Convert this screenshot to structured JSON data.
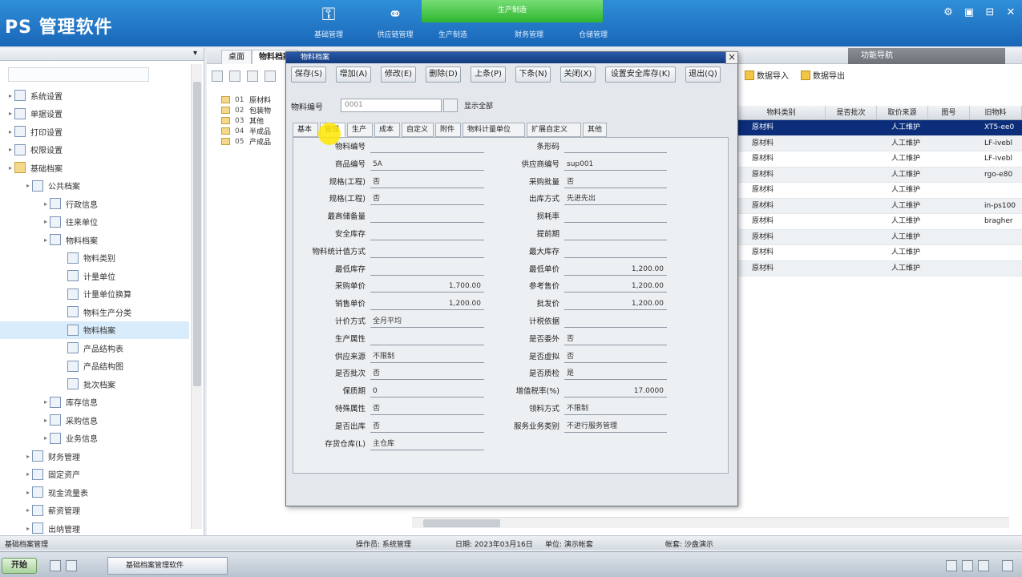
{
  "app": {
    "title": "PS 管理软件"
  },
  "nav": [
    {
      "label": "基础管理",
      "icon": "key-icon"
    },
    {
      "label": "供应链管理",
      "icon": "link-icon"
    },
    {
      "label": "生产制造",
      "icon": "factory-icon"
    },
    {
      "label": "财务管理",
      "icon": "ledger-icon"
    },
    {
      "label": "仓储管理",
      "icon": "warehouse-icon"
    }
  ],
  "window_controls": [
    "⚙",
    "▣",
    "⊟",
    "✕"
  ],
  "left_tree": [
    {
      "label": "系统设置",
      "level": 1
    },
    {
      "label": "单据设置",
      "level": 1
    },
    {
      "label": "打印设置",
      "level": 1
    },
    {
      "label": "权限设置",
      "level": 1
    },
    {
      "label": "基础档案",
      "level": 1
    },
    {
      "label": "公共档案",
      "level": 2
    },
    {
      "label": "行政信息",
      "level": 3
    },
    {
      "label": "往来单位",
      "level": 3
    },
    {
      "label": "物料档案",
      "level": 3
    },
    {
      "label": "物料类别",
      "level": 4
    },
    {
      "label": "计量单位",
      "level": 4
    },
    {
      "label": "计量单位换算",
      "level": 4
    },
    {
      "label": "物料生产分类",
      "level": 4
    },
    {
      "label": "物料档案",
      "level": 4
    },
    {
      "label": "产品结构表",
      "level": 4
    },
    {
      "label": "产品结构图",
      "level": 4
    },
    {
      "label": "批次档案",
      "level": 4
    },
    {
      "label": "库存信息",
      "level": 3
    },
    {
      "label": "采购信息",
      "level": 3
    },
    {
      "label": "业务信息",
      "level": 3
    },
    {
      "label": "财务管理",
      "level": 2
    },
    {
      "label": "固定资产",
      "level": 2
    },
    {
      "label": "现金流量表",
      "level": 2
    },
    {
      "label": "薪资管理",
      "level": 2
    },
    {
      "label": "出纳管理",
      "level": 2
    }
  ],
  "doc_tabs": [
    "桌面",
    "物料档案"
  ],
  "right_panel_title": "功能导航",
  "toolbar2": {
    "import": "数据导入",
    "export": "数据导出"
  },
  "category_tree": [
    {
      "code": "01",
      "name": "原材料"
    },
    {
      "code": "02",
      "name": "包装物"
    },
    {
      "code": "03",
      "name": "其他"
    },
    {
      "code": "04",
      "name": "半成品"
    },
    {
      "code": "05",
      "name": "产成品"
    }
  ],
  "grid": {
    "headers": [
      "物料类别",
      "是否批次",
      "取价来源",
      "图号",
      "旧物料"
    ],
    "rows": [
      [
        "原材料",
        "",
        "人工维护",
        "",
        "XT5-ee0"
      ],
      [
        "原材料",
        "",
        "人工维护",
        "",
        "LF-ivebl"
      ],
      [
        "原材料",
        "",
        "人工维护",
        "",
        "LF-ivebl"
      ],
      [
        "原材料",
        "",
        "人工维护",
        "",
        "rgo-e80"
      ],
      [
        "原材料",
        "",
        "人工维护",
        "",
        ""
      ],
      [
        "原材料",
        "",
        "人工维护",
        "",
        "in-ps100"
      ],
      [
        "原材料",
        "",
        "人工维护",
        "",
        "bragher"
      ],
      [
        "原材料",
        "",
        "人工维护",
        "",
        ""
      ],
      [
        "原材料",
        "",
        "人工维护",
        "",
        ""
      ],
      [
        "原材料",
        "",
        "人工维护",
        "",
        ""
      ]
    ],
    "selected_row": 0
  },
  "dialog": {
    "title": "物料档案",
    "close": "×",
    "buttons": [
      "保存(S)",
      "增加(A)",
      "修改(E)",
      "删除(D)",
      "上条(P)",
      "下条(N)",
      "关闭(X)",
      "设置安全库存(K)",
      "退出(Q)"
    ],
    "material_code_label": "物料编号",
    "material_code_value": "0001",
    "show_all_label": "显示全部",
    "tabs": [
      "基本",
      "管理",
      "生产",
      "成本",
      "自定义",
      "附件",
      "物料计量单位",
      "扩展自定义",
      "其他"
    ],
    "active_tab": 1,
    "left_fields": [
      {
        "label": "物料编号",
        "value": "",
        "num": false
      },
      {
        "label": "商品编号",
        "value": "5A",
        "num": false
      },
      {
        "label": "规格(工程)",
        "value": "否",
        "num": false
      },
      {
        "label": "规格(工程)",
        "value": "否",
        "num": false
      },
      {
        "label": "最高储备量",
        "value": "",
        "num": false
      },
      {
        "label": "安全库存",
        "value": "",
        "num": false
      },
      {
        "label": "物料统计值方式",
        "value": "",
        "num": false
      },
      {
        "label": "最低库存",
        "value": "",
        "num": false
      },
      {
        "label": "采购单价",
        "value": "1,700.00",
        "num": true
      },
      {
        "label": "销售单价",
        "value": "1,200.00",
        "num": true
      },
      {
        "label": "计价方式",
        "value": "全月平均",
        "num": false
      },
      {
        "label": "生产属性",
        "value": "",
        "num": false
      },
      {
        "label": "供应来源",
        "value": "不限制",
        "num": false
      },
      {
        "label": "是否批次",
        "value": "否",
        "num": false
      },
      {
        "label": "保质期",
        "value": "0",
        "num": false
      },
      {
        "label": "特殊属性",
        "value": "否",
        "num": false
      },
      {
        "label": "是否出库",
        "value": "否",
        "num": false
      },
      {
        "label": "存货仓库(L)",
        "value": "主仓库",
        "num": false
      }
    ],
    "right_fields": [
      {
        "label": "条形码",
        "value": "",
        "num": false
      },
      {
        "label": "供应商编号",
        "value": "sup001",
        "num": false
      },
      {
        "label": "采购批量",
        "value": "否",
        "num": false
      },
      {
        "label": "出库方式",
        "value": "先进先出",
        "num": false
      },
      {
        "label": "损耗率",
        "value": "",
        "num": false
      },
      {
        "label": "提前期",
        "value": "",
        "num": false
      },
      {
        "label": "最大库存",
        "value": "",
        "num": false
      },
      {
        "label": "最低单价",
        "value": "1,200.00",
        "num": true
      },
      {
        "label": "参考售价",
        "value": "1,200.00",
        "num": true
      },
      {
        "label": "批发价",
        "value": "1,200.00",
        "num": true
      },
      {
        "label": "计税依据",
        "value": "",
        "num": false
      },
      {
        "label": "是否委外",
        "value": "否",
        "num": false
      },
      {
        "label": "是否虚拟",
        "value": "否",
        "num": false
      },
      {
        "label": "是否质检",
        "value": "是",
        "num": false
      },
      {
        "label": "增值税率(%)",
        "value": "17.0000",
        "num": true
      },
      {
        "label": "领料方式",
        "value": "不限制",
        "num": false
      },
      {
        "label": "服务业务类别",
        "value": "不进行服务管理",
        "num": false
      }
    ]
  },
  "status": {
    "module": "基础档案管理",
    "operator": "操作员: 系统管理",
    "date": "日期: 2023年03月16日",
    "unit": "单位: 演示帐套",
    "right": "帐套: 沙盘演示"
  },
  "taskbar": {
    "start": "开始",
    "task": "基础档案管理软件"
  }
}
